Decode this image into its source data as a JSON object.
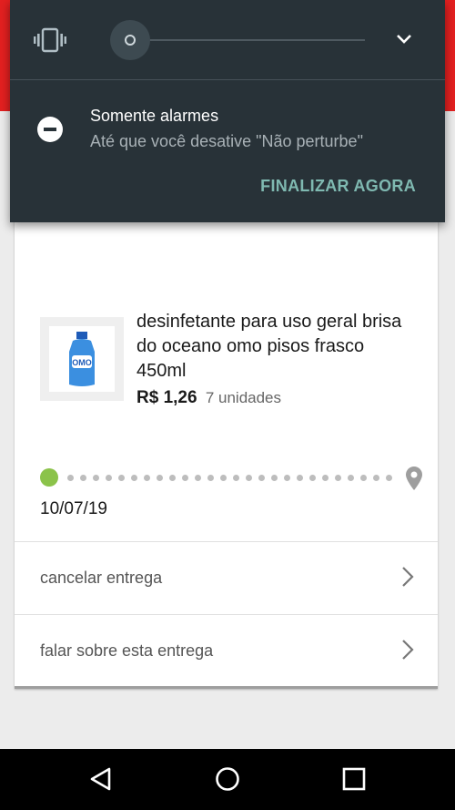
{
  "notification": {
    "dnd_title": "Somente alarmes",
    "dnd_subtitle": "Até que você desative \"Não perturbe\"",
    "finish_label": "FINALIZAR AGORA",
    "volume_level": 0.04
  },
  "product": {
    "name": "desinfetante para uso geral brisa do oceano omo pisos frasco 450ml",
    "price": "R$ 1,26",
    "units": "7 unidades",
    "image_text": "OMO"
  },
  "tracking": {
    "date": "10/07/19",
    "accent": "#8bc34a"
  },
  "actions": [
    {
      "label": "cancelar entrega"
    },
    {
      "label": "falar sobre esta entrega"
    }
  ],
  "colors": {
    "brand_red": "#e32020",
    "shade_bg": "#283238",
    "finish_text": "#7fb9b1"
  },
  "icons": [
    "vibrate-icon",
    "chevron-down-icon",
    "dnd-icon",
    "location-pin-icon",
    "chevron-right-icon",
    "back-icon",
    "home-icon",
    "recents-icon"
  ]
}
